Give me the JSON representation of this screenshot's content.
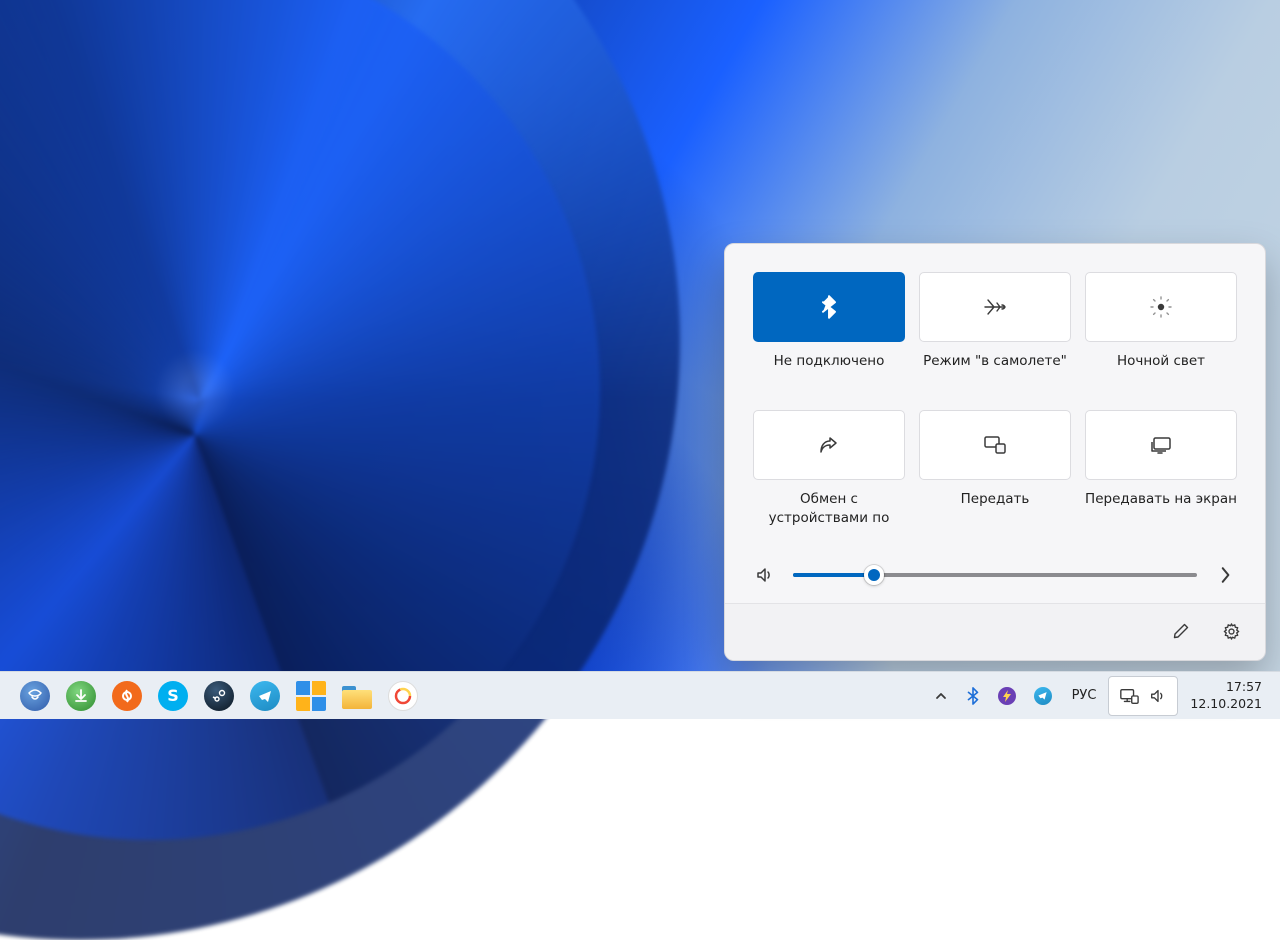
{
  "quick_settings": {
    "tiles": [
      {
        "label": "Не подключено",
        "icon": "bluetooth",
        "active": true
      },
      {
        "label": "Режим \"в самолете\"",
        "icon": "airplane",
        "active": false
      },
      {
        "label": "Ночной свет",
        "icon": "night-light",
        "active": false
      },
      {
        "label": "Обмен с устройствами по",
        "icon": "share",
        "active": false
      },
      {
        "label": "Передать",
        "icon": "cast",
        "active": false
      },
      {
        "label": "Передавать на экран",
        "icon": "project",
        "active": false
      }
    ],
    "volume_percent": 20
  },
  "taskbar": {
    "apps": [
      {
        "name": "thunderbird",
        "color": "#2f5aa8"
      },
      {
        "name": "download-manager",
        "color": "#2e8b2e"
      },
      {
        "name": "origin",
        "color": "#f26a1b"
      },
      {
        "name": "skype",
        "color": "#00aff0"
      },
      {
        "name": "steam",
        "color": "#1b2838"
      },
      {
        "name": "telegram",
        "color": "#2aa1da"
      },
      {
        "name": "window-tool",
        "color": "#2f8fe8"
      },
      {
        "name": "file-explorer",
        "color": "#f3c94b"
      },
      {
        "name": "yandex-music",
        "color": "#ffd34e"
      }
    ],
    "tray": {
      "overflow": "chevron-up",
      "icons": [
        "bluetooth",
        "bolt",
        "telegram"
      ],
      "language": "РУС",
      "network_icon": "ethernet",
      "volume_icon": "speaker"
    },
    "clock": {
      "time": "17:57",
      "date": "12.10.2021"
    }
  }
}
